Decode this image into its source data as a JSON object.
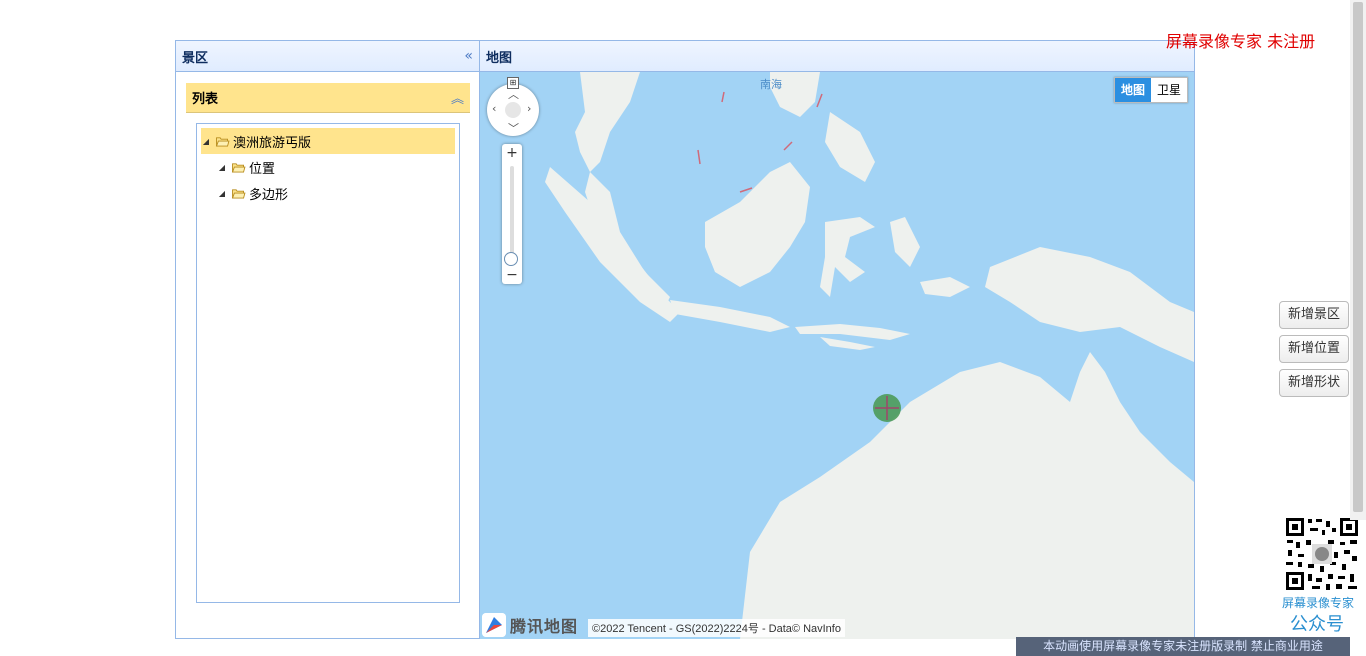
{
  "left_panel": {
    "title": "景区",
    "list_title": "列表",
    "tree": [
      {
        "label": "澳洲旅游丐版",
        "level": 0,
        "selected": true
      },
      {
        "label": "位置",
        "level": 1,
        "selected": false
      },
      {
        "label": "多边形",
        "level": 1,
        "selected": false
      }
    ]
  },
  "map_panel": {
    "title": "地图",
    "map_type": {
      "map": "地图",
      "satellite": "卫星",
      "active": "map"
    },
    "sea_label": "南海",
    "logo_text": "腾讯地图",
    "copyright": "©2022 Tencent - GS(2022)2224号 - Data© NavInfo",
    "zoom_level_fraction": 0.95
  },
  "side_buttons": {
    "add_scenic": "新增景区",
    "add_location": "新增位置",
    "add_shape": "新增形状"
  },
  "watermark": {
    "top": "屏幕录像专家  未注册",
    "qr_caption1": "屏幕录像专家",
    "qr_caption2": "公众号",
    "banner": "本动画使用屏幕录像专家未注册版录制  禁止商业用途"
  },
  "colors": {
    "water": "#a2d3f5",
    "land": "#eef1ee",
    "panel_border": "#95b8e7",
    "highlight": "#ffe48d",
    "watermark_red": "#e00000"
  }
}
